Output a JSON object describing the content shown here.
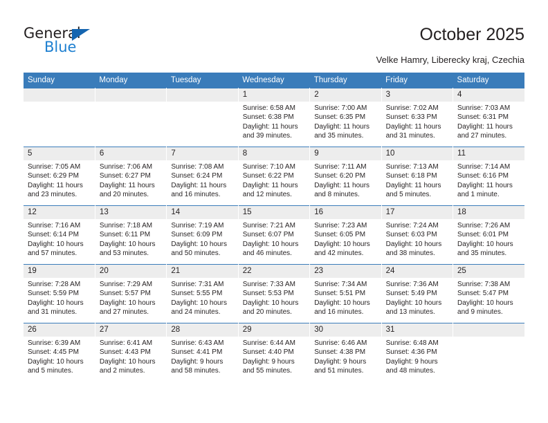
{
  "logo": {
    "word1": "General",
    "word2": "Blue",
    "triangle_icon": "triangle-icon",
    "brand_color": "#1d7fd0"
  },
  "header": {
    "title": "October 2025",
    "subtitle": "Velke Hamry, Liberecky kraj, Czechia"
  },
  "theme": {
    "header_bg": "#3a7cba",
    "daynum_bg": "#ededed",
    "text": "#231f20"
  },
  "calendar": {
    "weekday_headers": [
      "Sunday",
      "Monday",
      "Tuesday",
      "Wednesday",
      "Thursday",
      "Friday",
      "Saturday"
    ],
    "weeks": [
      [
        {
          "day": "",
          "lines": []
        },
        {
          "day": "",
          "lines": []
        },
        {
          "day": "",
          "lines": []
        },
        {
          "day": "1",
          "lines": [
            "Sunrise: 6:58 AM",
            "Sunset: 6:38 PM",
            "Daylight: 11 hours",
            "and 39 minutes."
          ]
        },
        {
          "day": "2",
          "lines": [
            "Sunrise: 7:00 AM",
            "Sunset: 6:35 PM",
            "Daylight: 11 hours",
            "and 35 minutes."
          ]
        },
        {
          "day": "3",
          "lines": [
            "Sunrise: 7:02 AM",
            "Sunset: 6:33 PM",
            "Daylight: 11 hours",
            "and 31 minutes."
          ]
        },
        {
          "day": "4",
          "lines": [
            "Sunrise: 7:03 AM",
            "Sunset: 6:31 PM",
            "Daylight: 11 hours",
            "and 27 minutes."
          ]
        }
      ],
      [
        {
          "day": "5",
          "lines": [
            "Sunrise: 7:05 AM",
            "Sunset: 6:29 PM",
            "Daylight: 11 hours",
            "and 23 minutes."
          ]
        },
        {
          "day": "6",
          "lines": [
            "Sunrise: 7:06 AM",
            "Sunset: 6:27 PM",
            "Daylight: 11 hours",
            "and 20 minutes."
          ]
        },
        {
          "day": "7",
          "lines": [
            "Sunrise: 7:08 AM",
            "Sunset: 6:24 PM",
            "Daylight: 11 hours",
            "and 16 minutes."
          ]
        },
        {
          "day": "8",
          "lines": [
            "Sunrise: 7:10 AM",
            "Sunset: 6:22 PM",
            "Daylight: 11 hours",
            "and 12 minutes."
          ]
        },
        {
          "day": "9",
          "lines": [
            "Sunrise: 7:11 AM",
            "Sunset: 6:20 PM",
            "Daylight: 11 hours",
            "and 8 minutes."
          ]
        },
        {
          "day": "10",
          "lines": [
            "Sunrise: 7:13 AM",
            "Sunset: 6:18 PM",
            "Daylight: 11 hours",
            "and 5 minutes."
          ]
        },
        {
          "day": "11",
          "lines": [
            "Sunrise: 7:14 AM",
            "Sunset: 6:16 PM",
            "Daylight: 11 hours",
            "and 1 minute."
          ]
        }
      ],
      [
        {
          "day": "12",
          "lines": [
            "Sunrise: 7:16 AM",
            "Sunset: 6:14 PM",
            "Daylight: 10 hours",
            "and 57 minutes."
          ]
        },
        {
          "day": "13",
          "lines": [
            "Sunrise: 7:18 AM",
            "Sunset: 6:11 PM",
            "Daylight: 10 hours",
            "and 53 minutes."
          ]
        },
        {
          "day": "14",
          "lines": [
            "Sunrise: 7:19 AM",
            "Sunset: 6:09 PM",
            "Daylight: 10 hours",
            "and 50 minutes."
          ]
        },
        {
          "day": "15",
          "lines": [
            "Sunrise: 7:21 AM",
            "Sunset: 6:07 PM",
            "Daylight: 10 hours",
            "and 46 minutes."
          ]
        },
        {
          "day": "16",
          "lines": [
            "Sunrise: 7:23 AM",
            "Sunset: 6:05 PM",
            "Daylight: 10 hours",
            "and 42 minutes."
          ]
        },
        {
          "day": "17",
          "lines": [
            "Sunrise: 7:24 AM",
            "Sunset: 6:03 PM",
            "Daylight: 10 hours",
            "and 38 minutes."
          ]
        },
        {
          "day": "18",
          "lines": [
            "Sunrise: 7:26 AM",
            "Sunset: 6:01 PM",
            "Daylight: 10 hours",
            "and 35 minutes."
          ]
        }
      ],
      [
        {
          "day": "19",
          "lines": [
            "Sunrise: 7:28 AM",
            "Sunset: 5:59 PM",
            "Daylight: 10 hours",
            "and 31 minutes."
          ]
        },
        {
          "day": "20",
          "lines": [
            "Sunrise: 7:29 AM",
            "Sunset: 5:57 PM",
            "Daylight: 10 hours",
            "and 27 minutes."
          ]
        },
        {
          "day": "21",
          "lines": [
            "Sunrise: 7:31 AM",
            "Sunset: 5:55 PM",
            "Daylight: 10 hours",
            "and 24 minutes."
          ]
        },
        {
          "day": "22",
          "lines": [
            "Sunrise: 7:33 AM",
            "Sunset: 5:53 PM",
            "Daylight: 10 hours",
            "and 20 minutes."
          ]
        },
        {
          "day": "23",
          "lines": [
            "Sunrise: 7:34 AM",
            "Sunset: 5:51 PM",
            "Daylight: 10 hours",
            "and 16 minutes."
          ]
        },
        {
          "day": "24",
          "lines": [
            "Sunrise: 7:36 AM",
            "Sunset: 5:49 PM",
            "Daylight: 10 hours",
            "and 13 minutes."
          ]
        },
        {
          "day": "25",
          "lines": [
            "Sunrise: 7:38 AM",
            "Sunset: 5:47 PM",
            "Daylight: 10 hours",
            "and 9 minutes."
          ]
        }
      ],
      [
        {
          "day": "26",
          "lines": [
            "Sunrise: 6:39 AM",
            "Sunset: 4:45 PM",
            "Daylight: 10 hours",
            "and 5 minutes."
          ]
        },
        {
          "day": "27",
          "lines": [
            "Sunrise: 6:41 AM",
            "Sunset: 4:43 PM",
            "Daylight: 10 hours",
            "and 2 minutes."
          ]
        },
        {
          "day": "28",
          "lines": [
            "Sunrise: 6:43 AM",
            "Sunset: 4:41 PM",
            "Daylight: 9 hours",
            "and 58 minutes."
          ]
        },
        {
          "day": "29",
          "lines": [
            "Sunrise: 6:44 AM",
            "Sunset: 4:40 PM",
            "Daylight: 9 hours",
            "and 55 minutes."
          ]
        },
        {
          "day": "30",
          "lines": [
            "Sunrise: 6:46 AM",
            "Sunset: 4:38 PM",
            "Daylight: 9 hours",
            "and 51 minutes."
          ]
        },
        {
          "day": "31",
          "lines": [
            "Sunrise: 6:48 AM",
            "Sunset: 4:36 PM",
            "Daylight: 9 hours",
            "and 48 minutes."
          ]
        },
        {
          "day": "",
          "lines": []
        }
      ]
    ]
  }
}
